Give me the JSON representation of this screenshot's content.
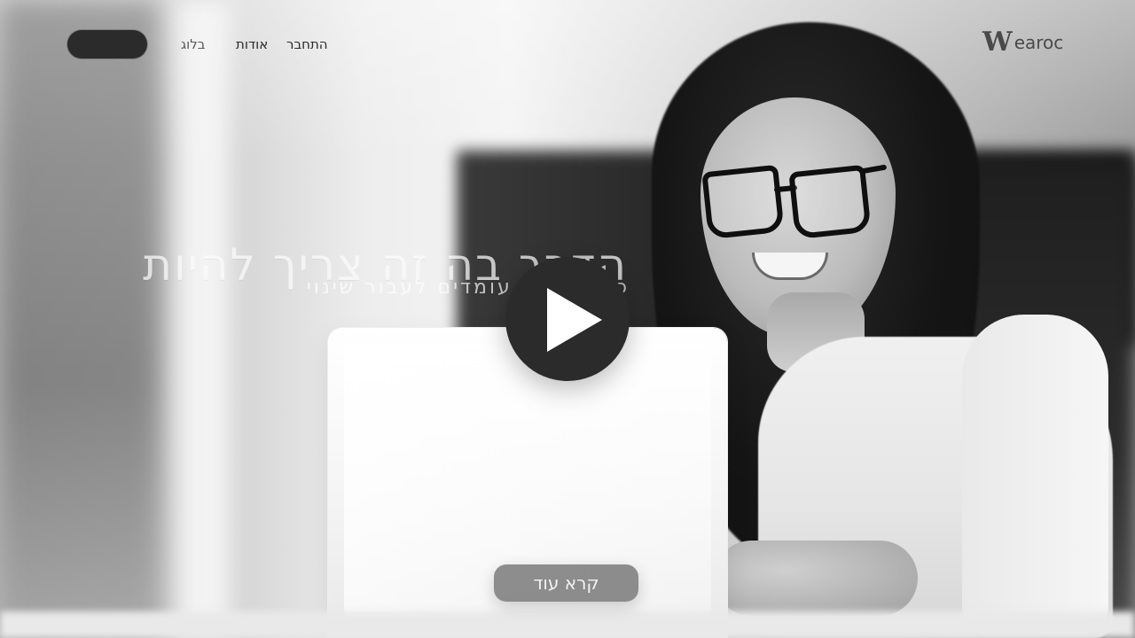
{
  "nav": {
    "pill_label": "",
    "links": {
      "blog": "בלוג",
      "about": "אודות",
      "login": "התחבר"
    },
    "logo": {
      "mark": "W",
      "text": "earoc"
    }
  },
  "hero": {
    "headline": "הדרך בה זה צריך להיות",
    "subline": "פנה שלכם עומדים לעבור שינוי",
    "play_button_icon": "play-icon",
    "cta_label": "קרא עוד"
  },
  "colors": {
    "play_bg": "#2b2b2b",
    "cta_bg": "#5a5a5a"
  }
}
